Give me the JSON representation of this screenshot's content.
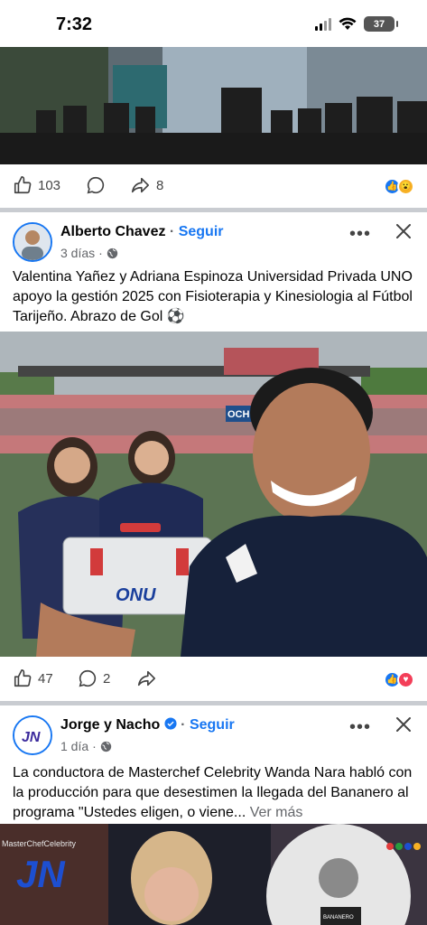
{
  "status_bar": {
    "time": "7:32",
    "battery": "37"
  },
  "post1": {
    "likes": "103",
    "shares": "8"
  },
  "post2": {
    "author": "Alberto Chavez",
    "follow": "Seguir",
    "time": "3 días",
    "text": "Valentina Yañez y Adriana Espinoza Universidad Privada UNO apoyo la gestión 2025 con Fisioterapia y Kinesiologia al Fútbol Tarijeño. Abrazo de Gol ⚽",
    "likes": "47",
    "comments": "2",
    "image_stadium_sign": "OCH",
    "image_box_logo": "ONU"
  },
  "post3": {
    "author": "Jorge y Nacho",
    "follow": "Seguir",
    "time": "1 día",
    "text": "La conductora de Masterchef Celebrity Wanda Nara habló con la producción para que desestimen la llegada del Bananero al programa \"Ustedes eligen, o viene...",
    "see_more": "Ver más",
    "avatar_text": "JN",
    "image_text": "MasterChefCelebrity",
    "image_logo": "JN",
    "image_apron": "BANANERO"
  },
  "colors": {
    "accent": "#1877f2",
    "like": "#1877f2",
    "love": "#f33e58",
    "wow": "#f7b125"
  },
  "icons": [
    "signal-icon",
    "wifi-icon",
    "battery-icon",
    "like-icon",
    "comment-icon",
    "share-icon",
    "globe-icon",
    "more-icon",
    "close-icon",
    "verified-icon"
  ]
}
